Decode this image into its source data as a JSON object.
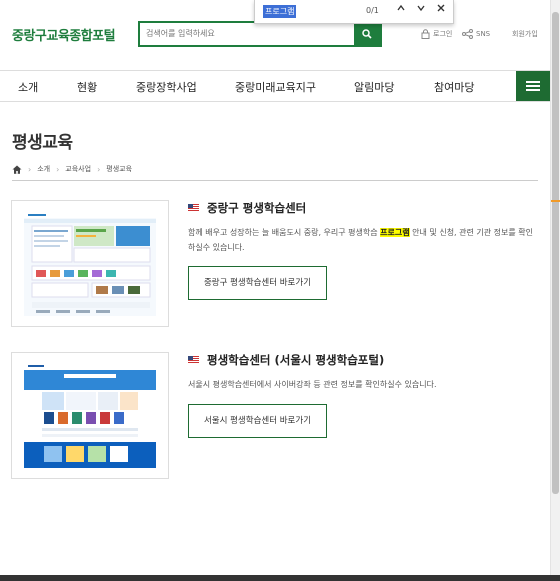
{
  "findbar": {
    "query": "프로그램",
    "count": "0/1",
    "prev_icon": "chevron-up-icon",
    "next_icon": "chevron-down-icon",
    "close_icon": "close-icon"
  },
  "header": {
    "logo": "중랑구교육종합포털",
    "search_placeholder": "검색어를 입력하세요",
    "login": "로그인",
    "sns": "SNS",
    "join": "회원가입",
    "brand_color": "#1e7d3d"
  },
  "nav": {
    "items": [
      "소개",
      "현황",
      "중랑장학사업",
      "중랑미래교육지구",
      "알림마당",
      "참여마당"
    ]
  },
  "page": {
    "title": "평생교육",
    "breadcrumb": [
      "소개",
      "교육사업",
      "평생교육"
    ]
  },
  "cards": [
    {
      "title": "중랑구 평생학습센터",
      "desc_before": "함께 배우고 성장하는 늘 배움도시 중랑, 우리구 평생학습 ",
      "desc_highlight": "프로그램",
      "desc_after": " 안내 및 신청, 관련 기관 정보를 확인하실수 있습니다.",
      "button": "중랑구 평생학습센터 바로가기"
    },
    {
      "title": "평생학습센터 (서울시 평생학습포털)",
      "desc_before": "서울시 평생학습센터에서 사이버강좌 등 관련 정보를 확인하실수 있습니다.",
      "desc_highlight": "",
      "desc_after": "",
      "button": "서울시 평생학습센터 바로가기"
    }
  ]
}
